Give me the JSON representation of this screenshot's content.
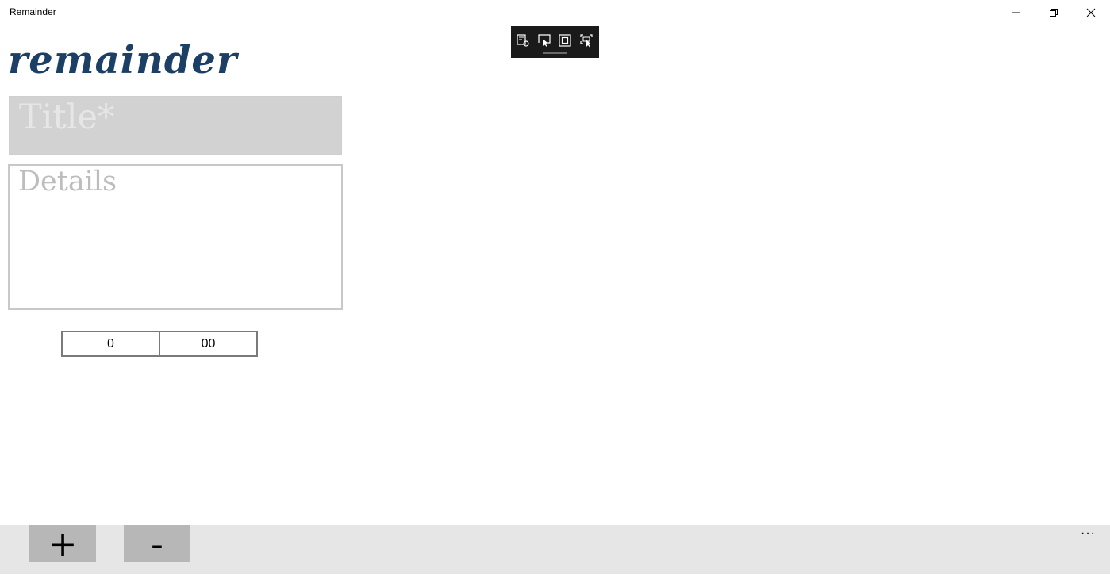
{
  "window": {
    "title": "Remainder",
    "icons": {
      "minimize": "minimize-icon",
      "maximize": "restore-icon",
      "close": "close-icon"
    }
  },
  "debug_toolbar": {
    "tools": [
      "live-visual-tree-icon",
      "select-element-icon",
      "display-layout-adorners-icon",
      "track-focused-element-icon"
    ]
  },
  "logo": {
    "text": "remainder",
    "color": "#1c3f66"
  },
  "form": {
    "title_placeholder": "Title*",
    "details_placeholder": "Details",
    "time": {
      "hours": "0",
      "minutes": "00"
    }
  },
  "appbar": {
    "add_label": "+",
    "remove_label": "-",
    "more_label": "···"
  }
}
